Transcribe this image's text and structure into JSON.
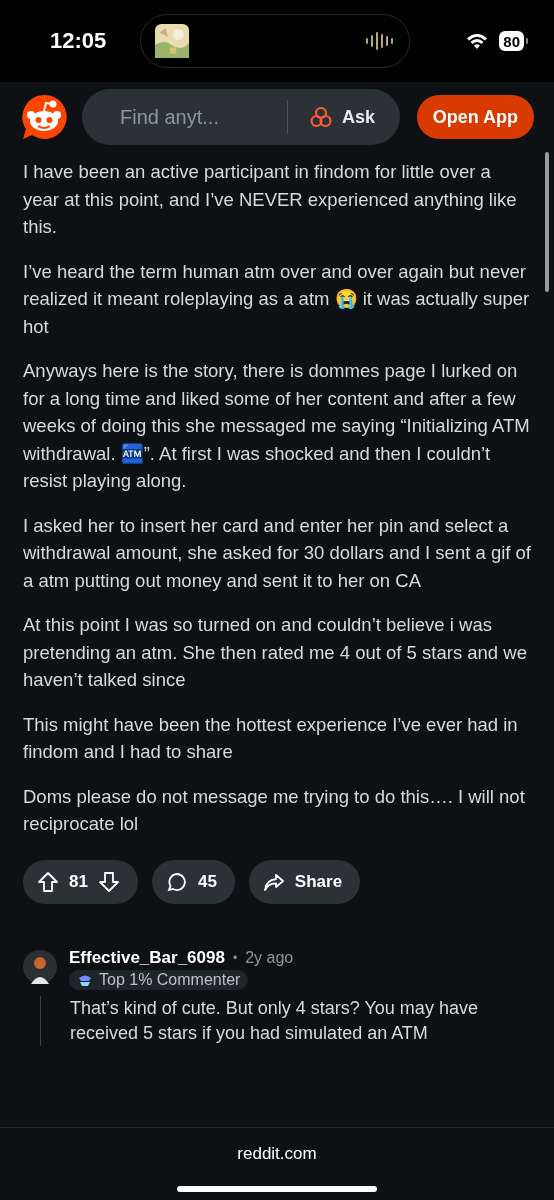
{
  "status_bar": {
    "time": "12:05",
    "battery": "80"
  },
  "header": {
    "search": {
      "placeholder": "Find anyt..."
    },
    "ask_label": "Ask",
    "open_app_label": "Open App"
  },
  "post": {
    "paragraphs": [
      "I have been an active participant in findom for little over a year at this point, and I’ve NEVER experienced anything like this.",
      "I’ve heard the term human atm over and over again but never realized it meant roleplaying as a atm 😭 it was actually super hot",
      "Anyways here is the story, there is dommes page I lurked on for a long time and liked some of her content and after a few weeks of doing this she messaged me saying “Initializing ATM withdrawal. 🏧”. At first I was shocked and then I couldn’t resist playing along.",
      "I asked her to insert her card and enter her pin and select a withdrawal amount, she asked for 30 dollars and I sent a gif of a atm putting out money and sent it to her on CA",
      "At this point I was so turned on and couldn’t believe i was pretending an atm. She then rated me 4 out of 5 stars and we haven’t talked since",
      "This might have been the hottest experience I’ve ever had in findom and I had to share",
      "Doms please do not message me trying to do this…. I will not reciprocate lol"
    ],
    "votes": "81",
    "comments": "45",
    "share_label": "Share"
  },
  "comment": {
    "author": "Effective_Bar_6098",
    "separator": "•",
    "age": "2y ago",
    "badge": "Top 1% Commenter",
    "text": "That’s kind of cute. But only 4 stars? You may have received 5 stars if you had simulated an ATM"
  },
  "bottom_bar": {
    "domain": "reddit.com"
  }
}
